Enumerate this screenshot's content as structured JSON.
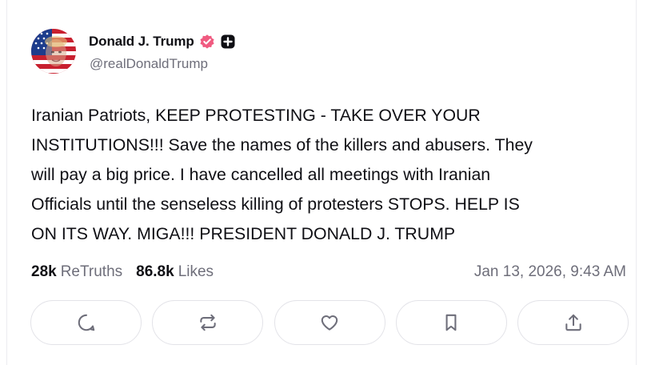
{
  "post": {
    "author": {
      "display_name": "Donald J. Trump",
      "handle": "@realDonaldTrump",
      "verified_icon": "verified-badge-icon",
      "extra_icon": "plus-square-icon"
    },
    "text": "Iranian Patriots, KEEP PROTESTING - TAKE OVER YOUR\nINSTITUTIONS!!! Save the names of the killers and abusers. They\nwill pay a big price. I have cancelled all meetings with Iranian\nOfficials until the senseless killing of protesters STOPS. HELP IS\nON ITS WAY. MIGA!!! PRESIDENT DONALD J. TRUMP",
    "stats": {
      "retruths_count": "28k",
      "retruths_label": "ReTruths",
      "likes_count": "86.8k",
      "likes_label": "Likes"
    },
    "timestamp": "Jan 13, 2026, 9:43 AM",
    "actions": [
      "reply-icon",
      "retruth-icon",
      "like-icon",
      "bookmark-icon",
      "share-icon"
    ]
  },
  "colors": {
    "text": "#0f0f14",
    "muted": "#6e6e7a",
    "verified": "#f05a80",
    "border": "#e3e3e8",
    "icon": "#6e6e7a"
  }
}
